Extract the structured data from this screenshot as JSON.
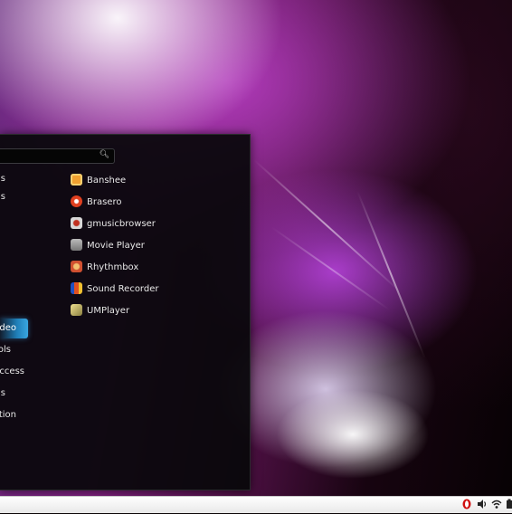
{
  "menu": {
    "search": {
      "placeholder": ""
    },
    "categories": [
      {
        "label": "s",
        "selected": false
      },
      {
        "label": "s",
        "selected": false
      },
      {
        "label": "ideo",
        "selected": true
      },
      {
        "label": "ols",
        "selected": false
      },
      {
        "label": "Access",
        "selected": false
      },
      {
        "label": "s",
        "selected": false
      },
      {
        "label": "tion",
        "selected": false
      }
    ],
    "apps": [
      {
        "label": "Banshee",
        "icon": "banshee-icon",
        "color": "#f0a030"
      },
      {
        "label": "Brasero",
        "icon": "brasero-icon",
        "color": "#e04020"
      },
      {
        "label": "gmusicbrowser",
        "icon": "gmusicbrowser-icon",
        "color": "#c0c0c0"
      },
      {
        "label": "Movie Player",
        "icon": "movie-player-icon",
        "color": "#9a9a9a"
      },
      {
        "label": "Rhythmbox",
        "icon": "rhythmbox-icon",
        "color": "#d05030"
      },
      {
        "label": "Sound Recorder",
        "icon": "sound-recorder-icon",
        "color": "#e05020"
      },
      {
        "label": "UMPlayer",
        "icon": "umplayer-icon",
        "color": "#d0c060"
      }
    ]
  },
  "tray": {
    "icons": [
      "opera-icon",
      "volume-icon",
      "wifi-icon",
      "battery-icon"
    ],
    "colors": {
      "opera": "#d01010",
      "dark": "#222222"
    }
  }
}
